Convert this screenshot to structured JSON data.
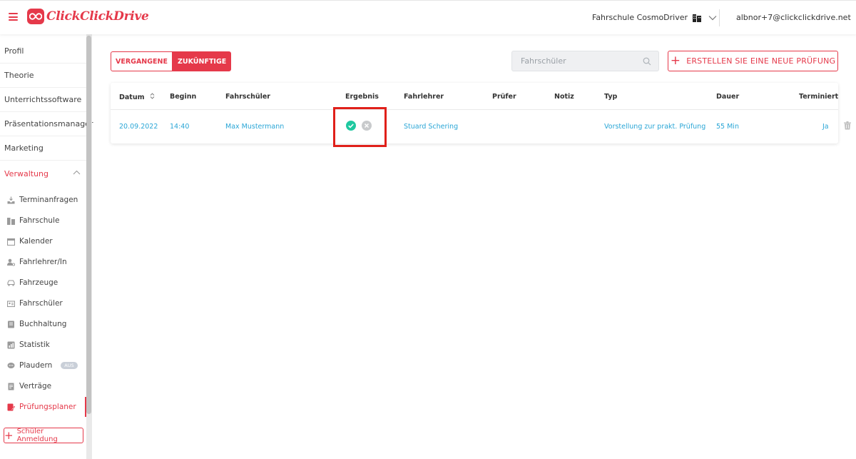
{
  "header": {
    "logo_text": "ClickClickDrive",
    "school_name": "Fahrschule CosmoDriver",
    "user_email": "albnor+7@clickclickdrive.net",
    "icons": [
      "menu-icon",
      "building-icon",
      "chevron-down-icon"
    ]
  },
  "sidebar": {
    "items": [
      {
        "label": "Profil"
      },
      {
        "label": "Theorie"
      },
      {
        "label": "Unterrichtssoftware"
      },
      {
        "label": "Präsentationsmanager"
      },
      {
        "label": "Marketing"
      },
      {
        "label": "Verwaltung"
      }
    ],
    "sub_items": [
      {
        "label": "Terminanfragen",
        "icon": "inbox-icon"
      },
      {
        "label": "Fahrschule",
        "icon": "building-icon"
      },
      {
        "label": "Kalender",
        "icon": "calendar-icon"
      },
      {
        "label": "Fahrlehrer/In",
        "icon": "instructor-icon"
      },
      {
        "label": "Fahrzeuge",
        "icon": "car-icon"
      },
      {
        "label": "Fahrschüler",
        "icon": "student-card-icon"
      },
      {
        "label": "Buchhaltung",
        "icon": "ledger-icon"
      },
      {
        "label": "Statistik",
        "icon": "chart-icon"
      },
      {
        "label": "Plaudern",
        "icon": "chat-icon",
        "badge": "AUS"
      },
      {
        "label": "Verträge",
        "icon": "contract-icon"
      },
      {
        "label": "Prüfungsplaner",
        "icon": "exam-planner-icon"
      }
    ],
    "signup_button": "Schüler Anmeldung"
  },
  "main": {
    "tabs": [
      {
        "label": "VERGANGENE"
      },
      {
        "label": "ZUKÜNFTIGE",
        "active": true
      }
    ],
    "search": {
      "placeholder": "Fahrschüler"
    },
    "create_button": "ERSTELLEN SIE EINE NEUE PRÜFUNG",
    "table": {
      "columns": [
        "Datum",
        "Beginn",
        "Fahrschüler",
        "Ergebnis",
        "Fahrlehrer",
        "Prüfer",
        "Notiz",
        "Typ",
        "Dauer",
        "Terminiert"
      ],
      "rows": [
        {
          "datum": "20.09.2022",
          "beginn": "14:40",
          "fahrschueler": "Max Mustermann",
          "ergebnis": [
            "check-circle-icon",
            "x-circle-icon"
          ],
          "fahrlehrer": "Stuard Schering",
          "pruefer": "",
          "notiz": "",
          "typ": "Vorstellung zur prakt. Prüfung",
          "dauer": "55 Min",
          "terminiert": "Ja"
        }
      ]
    }
  },
  "colors": {
    "accent": "#e5394a",
    "link": "#2aa6d6",
    "success": "#1fc8a0",
    "highlight": "#e0201a"
  }
}
